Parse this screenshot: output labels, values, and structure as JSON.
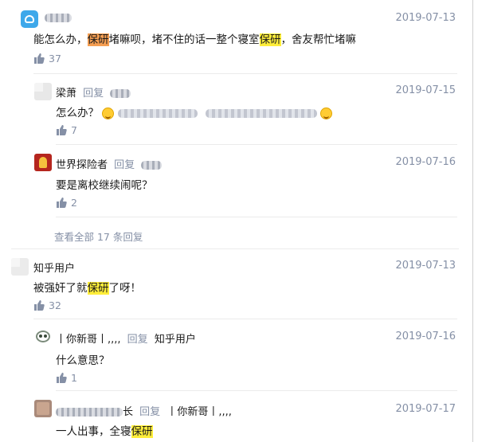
{
  "comments": [
    {
      "author": "",
      "date": "2019-07-13",
      "content_segments": [
        {
          "text": "能怎么办，",
          "hl": ""
        },
        {
          "text": "保研",
          "hl": "orange"
        },
        {
          "text": "堵嘛呗，堵不住的话一整个寝室",
          "hl": ""
        },
        {
          "text": "保研",
          "hl": "yellow"
        },
        {
          "text": "，舍友帮忙堵嘛",
          "hl": ""
        }
      ],
      "likes": "37"
    },
    {
      "author": "梁萧",
      "reply_word": "回复",
      "date": "2019-07-15",
      "content_prefix": "怎么办？",
      "likes": "7"
    },
    {
      "author": "世界探险者",
      "reply_word": "回复",
      "date": "2019-07-16",
      "content": "要是离校继续闹呢？",
      "likes": "2"
    },
    {
      "more_replies": "查看全部 17 条回复"
    },
    {
      "author": "知乎用户",
      "date": "2019-07-13",
      "content_segments": [
        {
          "text": "被强奸了就",
          "hl": ""
        },
        {
          "text": "保研",
          "hl": "yellow"
        },
        {
          "text": "了呀！",
          "hl": ""
        }
      ],
      "likes": "32"
    },
    {
      "author": "丨你新哥丨,,,,",
      "reply_word": "回复",
      "reply_to": "知乎用户",
      "date": "2019-07-16",
      "content": "什么意思？",
      "likes": "1"
    },
    {
      "author_suffix": "长",
      "reply_word": "回复",
      "reply_to": "丨你新哥丨,,,,",
      "date": "2019-07-17",
      "content_segments": [
        {
          "text": "一人出事，全寝",
          "hl": ""
        },
        {
          "text": "保研",
          "hl": "yellow"
        }
      ]
    }
  ],
  "colors": {
    "accent_gray": "#8590a6",
    "highlight_yellow": "#ffee3a",
    "highlight_orange": "#f59e52"
  },
  "icons": [
    "thumb-up-icon",
    "laugh-emoji-icon",
    "avatar"
  ]
}
